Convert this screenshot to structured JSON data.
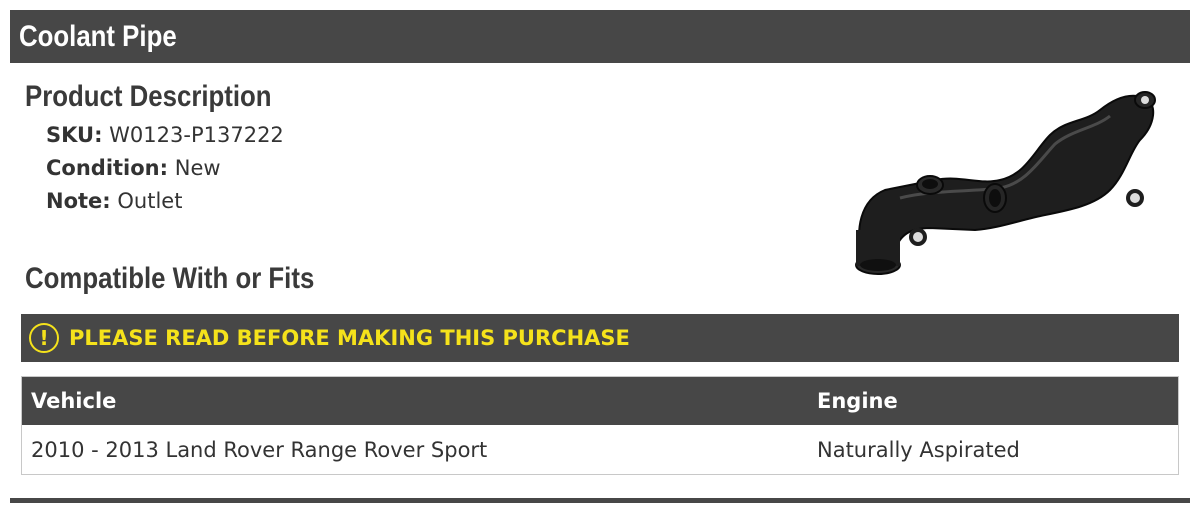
{
  "header": {
    "title": "Coolant Pipe"
  },
  "product_description": {
    "heading": "Product Description",
    "details": [
      {
        "label": "SKU:",
        "value": "W0123-P137222"
      },
      {
        "label": "Condition:",
        "value": "New"
      },
      {
        "label": "Note:",
        "value": "Outlet"
      }
    ]
  },
  "product_image": {
    "icon": "coolant-pipe-image"
  },
  "compatibility": {
    "heading": "Compatible With or Fits",
    "warning": {
      "icon": "exclamation-circle-icon",
      "icon_glyph": "!",
      "text": "PLEASE READ BEFORE MAKING THIS PURCHASE"
    },
    "table": {
      "columns": [
        "Vehicle",
        "Engine"
      ],
      "rows": [
        [
          "2010 - 2013 Land Rover Range Rover Sport",
          "Naturally Aspirated"
        ]
      ]
    }
  },
  "colors": {
    "bar_background": "#474747",
    "warning_text": "#f5e21b",
    "heading_text": "#3a3a3a",
    "body_text": "#333333"
  }
}
